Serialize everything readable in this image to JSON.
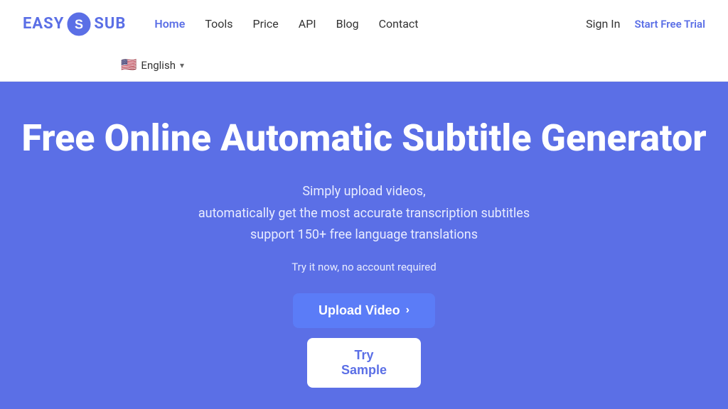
{
  "header": {
    "logo_text_easy": "EASY",
    "logo_text_sub": "SUB",
    "nav": {
      "items": [
        {
          "label": "Home",
          "active": true
        },
        {
          "label": "Tools",
          "active": false
        },
        {
          "label": "Price",
          "active": false
        },
        {
          "label": "API",
          "active": false
        },
        {
          "label": "Blog",
          "active": false
        },
        {
          "label": "Contact",
          "active": false
        }
      ]
    },
    "sign_in_label": "Sign In",
    "start_trial_label": "Start Free Trial",
    "language": {
      "flag": "🇺🇸",
      "label": "English",
      "chevron": "▾"
    }
  },
  "hero": {
    "title": "Free Online Automatic Subtitle Generator",
    "subtitle_line1": "Simply upload videos,",
    "subtitle_line2": "automatically get the most accurate transcription subtitles",
    "subtitle_line3": "support 150+ free language translations",
    "note": "Try it now, no account required",
    "upload_button_label": "Upload Video",
    "upload_button_chevron": "›",
    "try_sample_label": "Try Sample"
  }
}
